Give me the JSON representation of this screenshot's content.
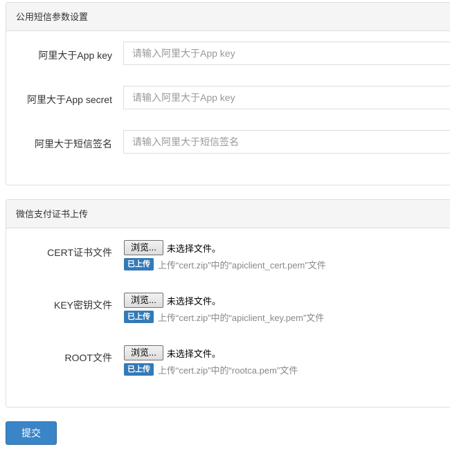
{
  "sms_panel": {
    "title": "公用短信参数设置",
    "fields": [
      {
        "label": "阿里大于App key",
        "placeholder": "请输入阿里大于App key",
        "value": ""
      },
      {
        "label": "阿里大于App secret",
        "placeholder": "请输入阿里大于App key",
        "value": ""
      },
      {
        "label": "阿里大于短信签名",
        "placeholder": "请输入阿里大于短信签名",
        "value": ""
      }
    ]
  },
  "cert_panel": {
    "title": "微信支付证书上传",
    "browse_label": "浏览...",
    "no_file_text": "未选择文件。",
    "badge_label": "已上传",
    "files": [
      {
        "label": "CERT证书文件",
        "hint": "上传“cert.zip”中的“apiclient_cert.pem”文件"
      },
      {
        "label": "KEY密钥文件",
        "hint": "上传“cert.zip”中的“apiclient_key.pem”文件"
      },
      {
        "label": "ROOT文件",
        "hint": "上传“cert.zip”中的“rootca.pem”文件"
      }
    ]
  },
  "submit_label": "提交",
  "colors": {
    "primary": "#3a85c8",
    "badge": "#337ab7",
    "panel_heading_bg": "#f5f5f5",
    "border": "#dddddd"
  }
}
